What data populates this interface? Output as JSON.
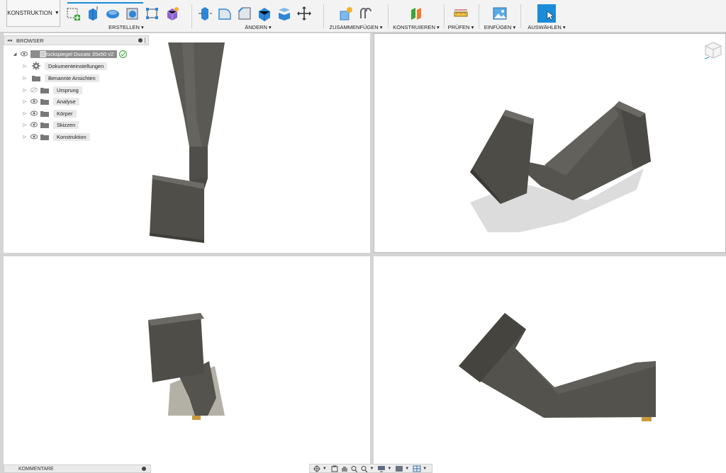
{
  "toolbar": {
    "workspace": "KONSTRUKTION",
    "groups": {
      "erstellen": "ERSTELLEN",
      "aendern": "ÄNDERN",
      "zusammenfuegen": "ZUSAMMENFÜGEN",
      "konstruieren": "KONSTRUIEREN",
      "pruefen": "PRÜFEN",
      "einfuegen": "EINFÜGEN",
      "auswaehlen": "AUSWÄHLEN"
    },
    "accent": "#1a8cd8"
  },
  "browser": {
    "title": "BROWSER",
    "root": "Rückspiegel Ducato 35x50 v2",
    "items": [
      {
        "label": "Dokumenteinstellungen",
        "icon": "gear-icon"
      },
      {
        "label": "Benannte Ansichten",
        "icon": "folder-icon"
      },
      {
        "label": "Ursprung",
        "icon": "folder-icon"
      },
      {
        "label": "Analyse",
        "icon": "folder-icon"
      },
      {
        "label": "Körper",
        "icon": "folder-icon"
      },
      {
        "label": "Skizzen",
        "icon": "folder-icon"
      },
      {
        "label": "Konstruktion",
        "icon": "folder-icon"
      }
    ]
  },
  "comments": {
    "title": "KOMMENTARE"
  },
  "colors": {
    "model": "#55544f",
    "model_dark": "#3f3e3a",
    "shadow": "#dddddd",
    "viewport": "#ffffff"
  }
}
